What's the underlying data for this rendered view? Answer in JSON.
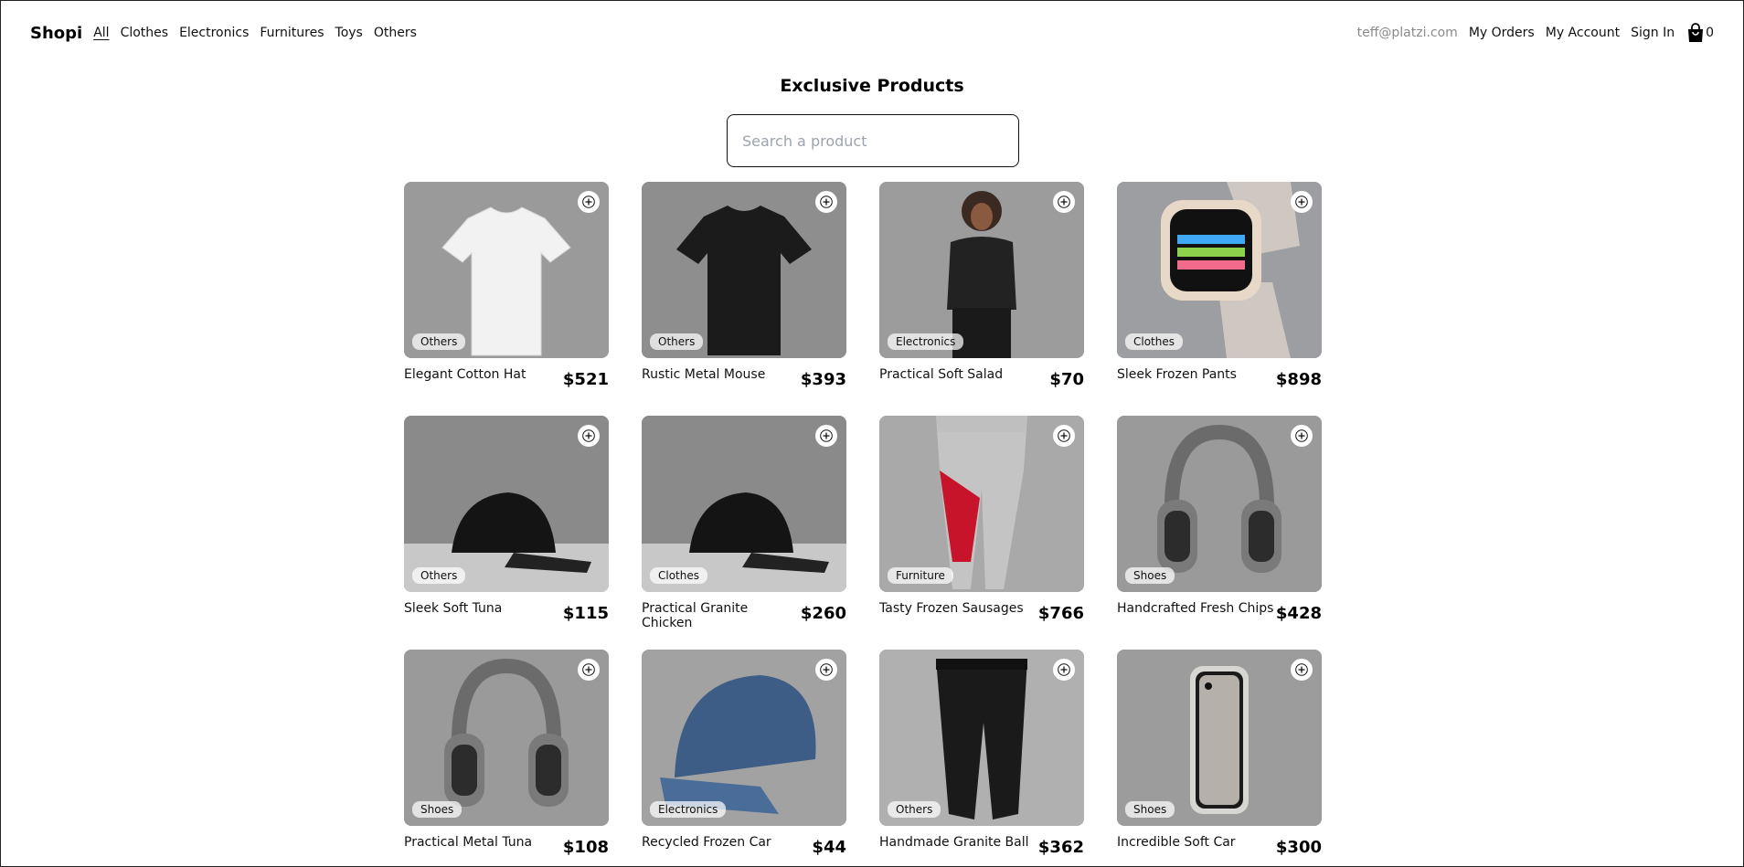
{
  "navbar": {
    "brand": "Shopi",
    "categories": [
      "All",
      "Clothes",
      "Electronics",
      "Furnitures",
      "Toys",
      "Others"
    ],
    "email": "teff@platzi.com",
    "my_orders": "My Orders",
    "my_account": "My Account",
    "sign_in": "Sign In",
    "cart_count": "0"
  },
  "main": {
    "title": "Exclusive Products",
    "search_placeholder": "Search a product"
  },
  "products": [
    {
      "name": "Elegant Cotton Hat",
      "price": "$521",
      "category": "Others",
      "image": "white-tshirt"
    },
    {
      "name": "Rustic Metal Mouse",
      "price": "$393",
      "category": "Others",
      "image": "black-tshirt"
    },
    {
      "name": "Practical Soft Salad",
      "price": "$70",
      "category": "Electronics",
      "image": "woman-tshirt"
    },
    {
      "name": "Sleek Frozen Pants",
      "price": "$898",
      "category": "Clothes",
      "image": "smartwatch"
    },
    {
      "name": "Sleek Soft Tuna",
      "price": "$115",
      "category": "Others",
      "image": "black-cap"
    },
    {
      "name": "Practical Granite Chicken",
      "price": "$260",
      "category": "Clothes",
      "image": "black-cap"
    },
    {
      "name": "Tasty Frozen Sausages",
      "price": "$766",
      "category": "Furniture",
      "image": "red-gray-joggers"
    },
    {
      "name": "Handcrafted Fresh Chips",
      "price": "$428",
      "category": "Shoes",
      "image": "headphones"
    },
    {
      "name": "Practical Metal Tuna",
      "price": "$108",
      "category": "Shoes",
      "image": "headphones"
    },
    {
      "name": "Recycled Frozen Car",
      "price": "$44",
      "category": "Electronics",
      "image": "blue-cap"
    },
    {
      "name": "Handmade Granite Ball",
      "price": "$362",
      "category": "Others",
      "image": "black-joggers"
    },
    {
      "name": "Incredible Soft Car",
      "price": "$300",
      "category": "Shoes",
      "image": "phone"
    }
  ]
}
